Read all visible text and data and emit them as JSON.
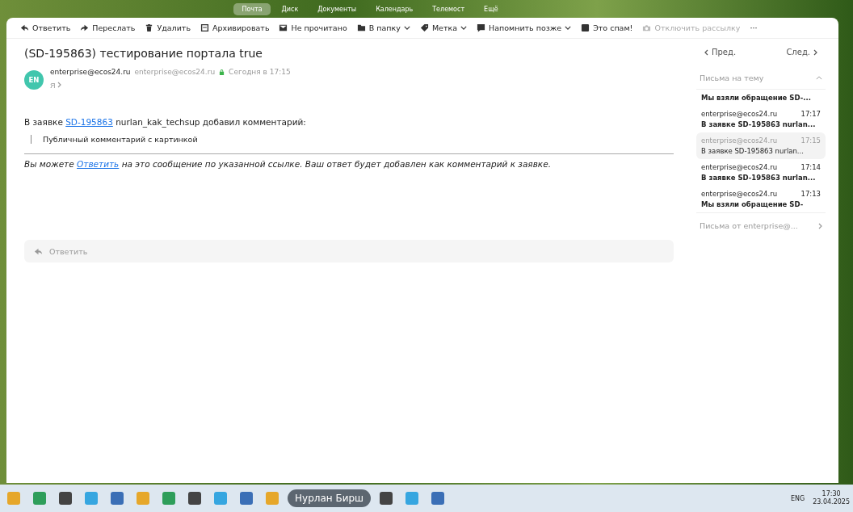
{
  "top_nav": [
    {
      "label": "Почта",
      "selected": true
    },
    {
      "label": "Диск",
      "selected": false
    },
    {
      "label": "Документы",
      "selected": false
    },
    {
      "label": "Календарь",
      "selected": false
    },
    {
      "label": "Телемост",
      "selected": false
    },
    {
      "label": "Ещё",
      "selected": false
    }
  ],
  "toolbar": [
    {
      "label": "Ответить",
      "disabled": false
    },
    {
      "label": "Переслать",
      "disabled": false
    },
    {
      "label": "Удалить",
      "disabled": false
    },
    {
      "label": "Архивировать",
      "disabled": false
    },
    {
      "label": "Не прочитано",
      "disabled": false
    },
    {
      "label": "В папку",
      "disabled": false
    },
    {
      "label": "Метка",
      "disabled": false
    },
    {
      "label": "Напомнить позже",
      "disabled": false
    },
    {
      "label": "Это спам!",
      "disabled": false
    },
    {
      "label": "Отключить рассылку",
      "disabled": true
    },
    {
      "label": "···",
      "disabled": false
    }
  ],
  "message": {
    "subject": "(SD-195863) тестирование портала true",
    "avatar": "EN",
    "sender_name": "enterprise@ecos24.ru",
    "sender_email": "enterprise@ecos24.ru",
    "date": "Сегодня в 17:15",
    "recipient": "Я",
    "body_prefix": "В заявке",
    "body_link": "SD-195863",
    "body_suffix": "nurlan_kak_techsup добавил комментарий:",
    "quote": "Публичный комментарий с картинкой",
    "footer_prefix": "Вы можете",
    "footer_link": "Ответить",
    "footer_suffix": "на это сообщение по указанной ссылке. Ваш ответ будет добавлен как комментарий к заявке."
  },
  "reply_box": {
    "label": "Ответить"
  },
  "side": {
    "prev": "Пред.",
    "next": "След.",
    "thread_title": "Письма на тему",
    "expanded": true,
    "thread": [
      {
        "subject": "Мы взяли обращение SD-...",
        "unread": true,
        "selected": false
      },
      {
        "sender": "enterprise@ecos24.ru",
        "time": "17:17",
        "subject": "В заявке SD-195863 nurlan...",
        "unread": true,
        "selected": false
      },
      {
        "sender": "enterprise@ecos24.ru",
        "time": "17:15",
        "subject": "В заявке SD-195863 nurlan...",
        "unread": false,
        "selected": true
      },
      {
        "sender": "enterprise@ecos24.ru",
        "time": "17:14",
        "subject": "В заявке SD-195863 nurlan...",
        "unread": true,
        "selected": false
      },
      {
        "sender": "enterprise@ecos24.ru",
        "time": "17:13",
        "subject": "Мы взяли обращение SD-",
        "unread": true,
        "selected": false
      }
    ],
    "from_sender": "Письма от enterprise@..."
  },
  "taskbar": {
    "pill": "Нурлан Бирш",
    "lang": "ENG",
    "time": "17:30",
    "date": "23.04.2025"
  }
}
